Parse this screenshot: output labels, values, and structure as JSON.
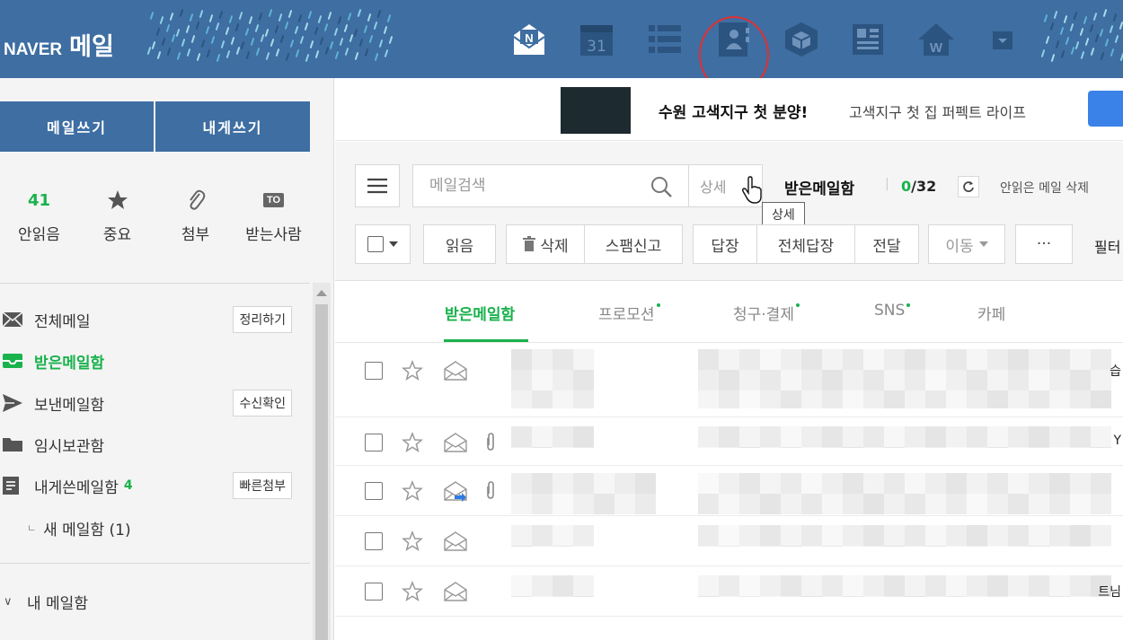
{
  "header": {
    "brand": "NAVER",
    "product": "메일",
    "apps": [
      {
        "name": "mail-app-icon",
        "icon": "envelope-N"
      },
      {
        "name": "calendar-app-icon",
        "icon": "calendar",
        "text": "31"
      },
      {
        "name": "todo-app-icon",
        "icon": "list"
      },
      {
        "name": "contacts-app-icon",
        "icon": "contacts"
      },
      {
        "name": "mybox-app-icon",
        "icon": "box"
      },
      {
        "name": "office-app-icon",
        "icon": "office"
      },
      {
        "name": "home-app-icon",
        "icon": "house-W"
      },
      {
        "name": "more-app-icon",
        "icon": "dropdown"
      }
    ]
  },
  "sidebar": {
    "write_mail": "메일쓰기",
    "write_to_me": "내게쓰기",
    "quick": [
      {
        "label": "안읽음",
        "value": "41"
      },
      {
        "label": "중요"
      },
      {
        "label": "첨부"
      },
      {
        "label": "받는사람",
        "badge": "TO"
      }
    ],
    "folders": [
      {
        "label": "전체메일",
        "action": "정리하기"
      },
      {
        "label": "받은메일함"
      },
      {
        "label": "보낸메일함",
        "action": "수신확인"
      },
      {
        "label": "임시보관함"
      },
      {
        "label": "내게쓴메일함",
        "badge": "4",
        "action": "빠른첨부"
      },
      {
        "label": "새 메일함 (1)",
        "prefix": "ㄴ"
      }
    ],
    "my_folders": "내 메일함",
    "my_folders_chevron": "∨"
  },
  "ad": {
    "title": "수원 고색지구 첫 분양!",
    "subtitle": "고색지구 첫 집 퍼펙트 라이프"
  },
  "toolbar": {
    "search_placeholder": "메일검색",
    "detail": "상세",
    "folder_name": "받은메일함",
    "unread_count": "0",
    "total_count": "/32",
    "unread_delete": "안읽은 메일 삭제",
    "tooltip": "상세",
    "buttons": {
      "read": "읽음",
      "delete": "삭제",
      "spam": "스팸신고",
      "reply": "답장",
      "reply_all": "전체답장",
      "forward": "전달",
      "move": "이동",
      "more": "···"
    },
    "filter": "필터"
  },
  "tabs": [
    {
      "label": "받은메일함",
      "active": true
    },
    {
      "label": "프로모션",
      "dot": true
    },
    {
      "label": "청구·결제",
      "dot": true
    },
    {
      "label": "SNS",
      "dot": true
    },
    {
      "label": "카페"
    }
  ],
  "mail_rows": [
    {
      "trail": "습",
      "attach": false,
      "forwarded": false
    },
    {
      "trail": "Y",
      "attach": true,
      "forwarded": false
    },
    {
      "trail": "",
      "attach": true,
      "forwarded": true
    },
    {
      "trail": "",
      "attach": false,
      "forwarded": false
    },
    {
      "trail": "트님",
      "attach": false,
      "forwarded": false
    }
  ],
  "colors": {
    "header_bg": "#3e6ea2",
    "accent_green": "#19b24c",
    "annotation_red": "#e03030"
  }
}
